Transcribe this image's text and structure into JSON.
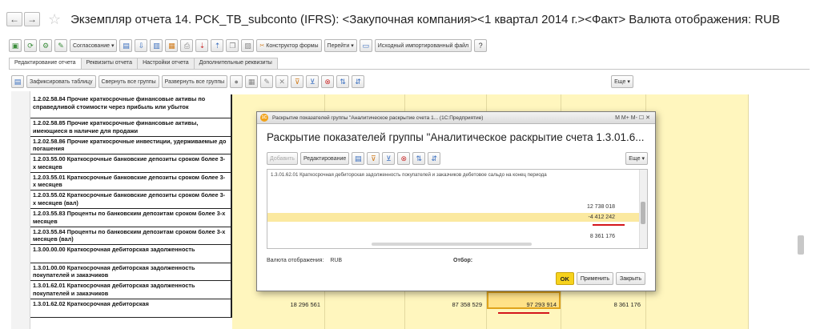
{
  "window": {
    "title": "Экземпляр отчета 14. PCK_TB_subconto (IFRS): <Закупочная компания><1 квартал 2014 г.><Факт> Валюта отображения: RUB",
    "back_icon": "←",
    "forward_icon": "→",
    "star_icon": "☆"
  },
  "toolbar1": {
    "approval_label": "Согласование ▾",
    "form_builder_label": "Конструктор формы",
    "goto_label": "Перейти ▾",
    "source_file_label": "Исходный импортированный файл",
    "help_label": "?"
  },
  "tabs": [
    "Редактирование отчета",
    "Реквизиты отчета",
    "Настройки отчета",
    "Дополнительные реквизиты"
  ],
  "toolbar2": {
    "fix_table_label": "Зафиксировать таблицу",
    "collapse_label": "Свернуть все группы",
    "expand_label": "Развернуть все группы",
    "more_label": "Еще ▾"
  },
  "sheet": {
    "row_labels": [
      "1.2.02.58.84 Прочие краткосрочные финансовые активы по справедливой стоимости через прибыль или убыток",
      "1.2.02.58.85 Прочие краткосрочные финансовые активы, имеющиеся в наличие для продажи",
      "1.2.02.58.86 Прочие краткосрочные инвестиции, удерживаемые до погашения",
      "1.2.03.55.00 Краткосрочные банковские депозиты сроком более 3-х месяцев",
      "1.2.03.55.01 Краткосрочные банковские депозиты сроком более 3-х месяцев",
      "1.2.03.55.02 Краткосрочные банковские депозиты сроком более 3-х месяцев (вал)",
      "1.2.03.55.83 Проценты по банковским депозитам сроком более 3-х месяцев",
      "1.2.03.55.84 Проценты по банковским депозитам сроком более 3-х месяцев (вал)",
      "1.3.00.00.00 Краткосрочная дебиторская задолженность",
      "1.3.01.00.00 Краткосрочная дебиторская задолженность покупателей и заказчиков",
      "1.3.01.62.01 Краткосрочная дебиторская задолженность покупателей и заказчиков",
      "1.3.01.62.02 Краткосрочная дебиторская"
    ],
    "values": {
      "col1": "18 296 561",
      "col2": "87 358 529",
      "col3": "97 293 914",
      "col4": "8 361 176"
    }
  },
  "dialog": {
    "window_title": "Раскрытие показателей группы \"Аналитическое раскрытие счета 1... (1С:Предприятие)",
    "window_controls": "M  M+  M-  ☐  ✕",
    "heading": "Раскрытие показателей группы \"Аналитическое раскрытие счета 1.3.01.6...",
    "add_label": "Добавить",
    "edit_label": "Редактирование",
    "more_label": "Еще ▾",
    "row_text": "1.3.01.62.01 Краткосрочная дебиторская задолженность покупателей и заказчиков дебетовое сальдо на конец периода",
    "values": [
      "12 738 018",
      "-4 412 242",
      "8 361 176"
    ],
    "currency_label": "Валюта отображения:",
    "currency_value": "RUB",
    "filter_label": "Отбор:",
    "ok_label": "OK",
    "apply_label": "Применить",
    "close_label": "Закрыть"
  },
  "colors": {
    "highlight_yellow": "#fff6be",
    "selected_cell": "#ffe289",
    "accent_red": "#d4161b",
    "ok_button": "#f6d21c"
  }
}
